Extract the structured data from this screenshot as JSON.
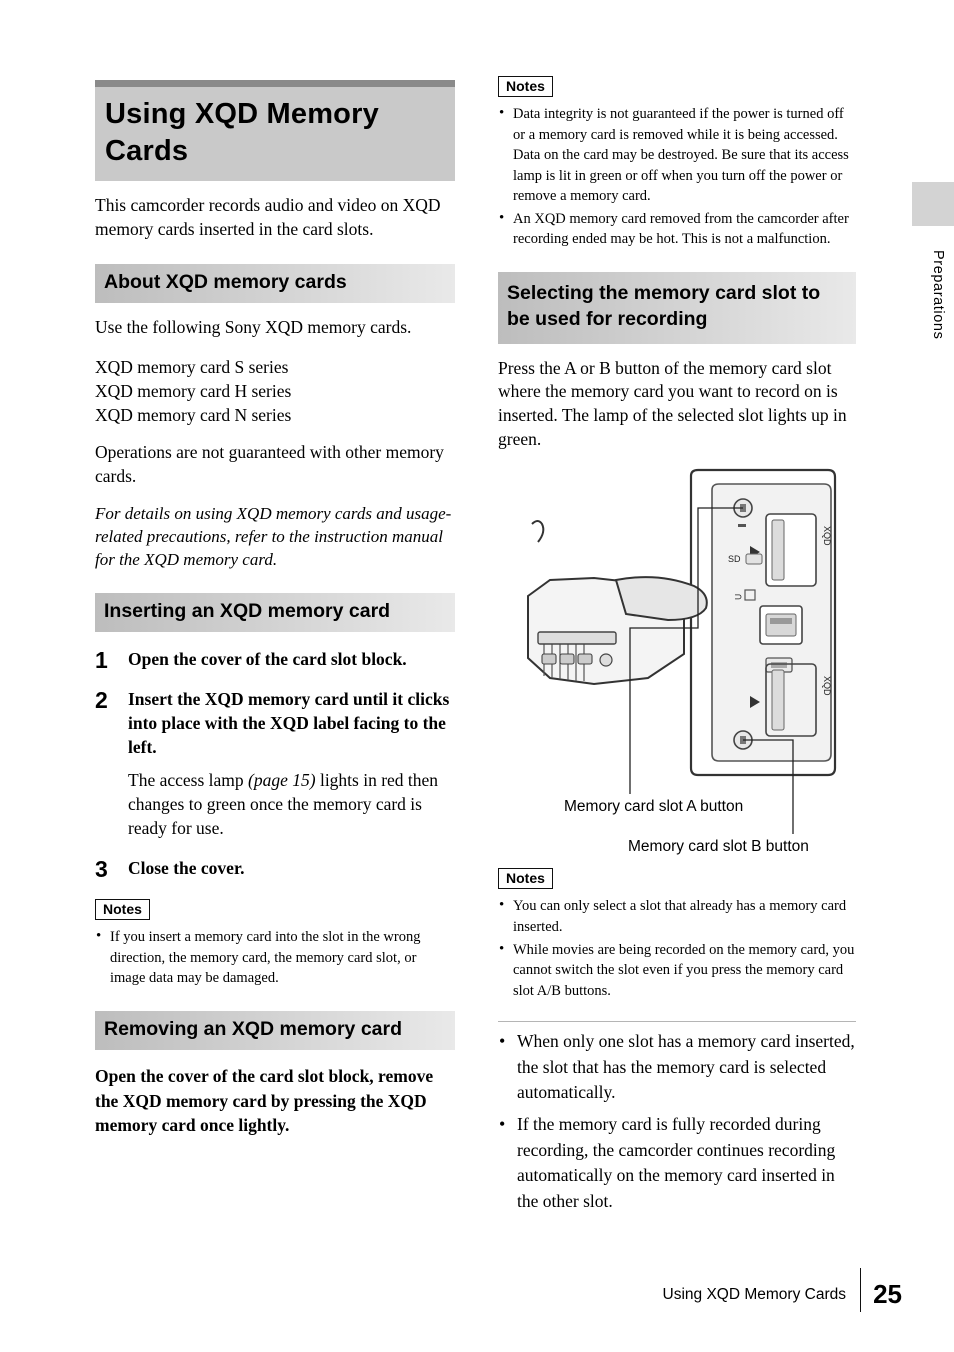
{
  "page": {
    "number": "25",
    "footer_text": "Using XQD Memory Cards",
    "side_label": "Preparations"
  },
  "left": {
    "title": "Using XQD Memory Cards",
    "intro": "This camcorder records audio and video on XQD memory cards inserted in the card slots.",
    "about": {
      "heading": "About XQD memory cards",
      "para1": "Use the following Sony XQD memory cards.",
      "cards": [
        "XQD memory card S series",
        "XQD memory card H series",
        "XQD memory card N series"
      ],
      "para2": "Operations are not guaranteed with other memory cards.",
      "italic": "For details on using XQD memory cards and usage-related precautions, refer to the instruction manual for the XQD memory card."
    },
    "inserting": {
      "heading": "Inserting an XQD memory card",
      "steps": [
        {
          "num": "1",
          "text": "Open the cover of the card slot block."
        },
        {
          "num": "2",
          "text": "Insert the XQD memory card until it clicks into place with the XQD label facing to the left.",
          "sub": "The access lamp (page 15) lights in red then changes to green once the memory card is ready for use."
        },
        {
          "num": "3",
          "text": "Close the cover."
        }
      ],
      "notes_label": "Notes",
      "notes": [
        "If you insert a memory card into the slot in the wrong direction, the memory card, the memory card slot, or image data may be damaged."
      ]
    },
    "removing": {
      "heading": "Removing an XQD memory card",
      "text": "Open the cover of the card slot block, remove the XQD memory card by pressing the XQD memory card once lightly."
    }
  },
  "right": {
    "top_notes_label": "Notes",
    "top_notes": [
      "Data integrity is not guaranteed if the power is turned off or a memory card is removed while it is being accessed. Data on the card may be destroyed. Be sure that its access lamp is lit in green or off when you turn off the power or remove a memory card.",
      "An XQD memory card removed from the camcorder after recording ended may be hot. This is not a malfunction."
    ],
    "selecting": {
      "heading": "Selecting the memory card slot to be used for recording",
      "para": "Press the A or B button of the memory card slot where the memory card you want to record on is inserted. The lamp of the selected slot lights up in green.",
      "caption_a": "Memory card slot A button",
      "caption_b": "Memory card slot B button",
      "figure_labels": {
        "xqd_top": "XQD",
        "xqd_bottom": "XQD",
        "sd": "SD",
        "usb": "USB"
      }
    },
    "notes_label": "Notes",
    "notes": [
      "You can only select a slot that already has a memory card inserted.",
      "While movies are being recorded on the memory card, you cannot switch the slot even if you press the memory card slot A/B buttons."
    ],
    "bullets": [
      "When only one slot has a memory card inserted, the slot that has the memory card is selected automatically.",
      "If the memory card is fully recorded during recording, the camcorder continues recording automatically on the memory card inserted in the other slot."
    ]
  }
}
